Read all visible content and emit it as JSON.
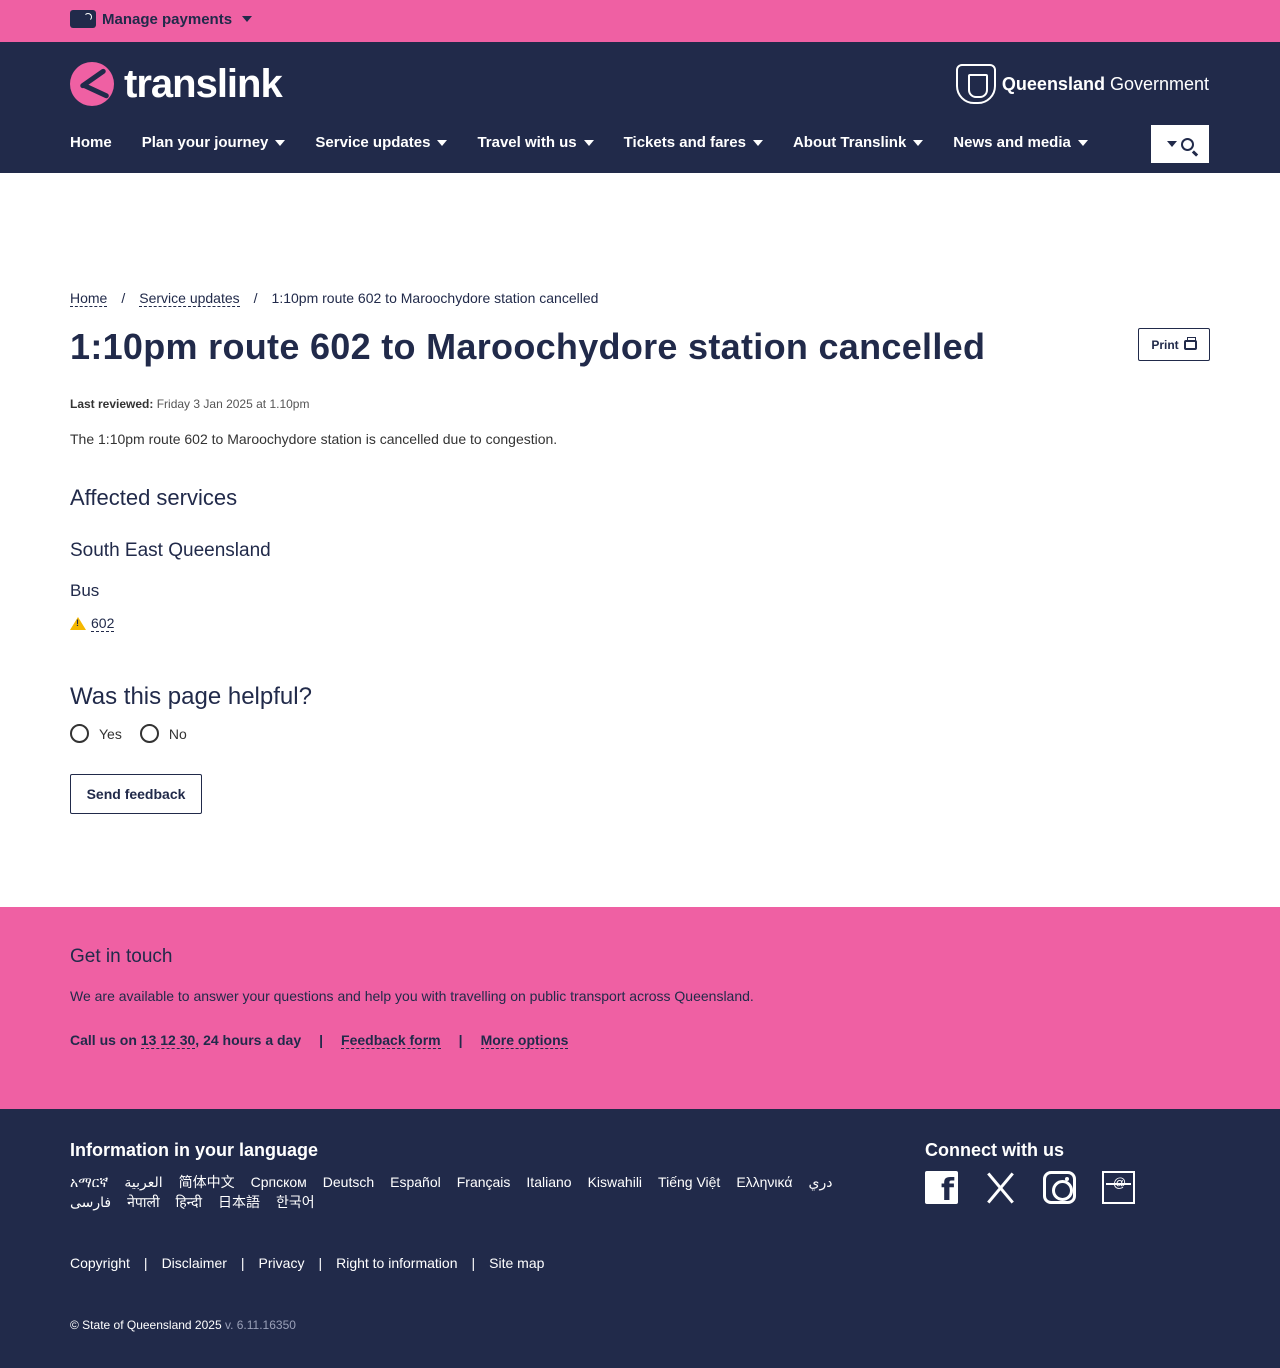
{
  "topbar": {
    "manage_payments": "Manage payments"
  },
  "header": {
    "logo_text": "translink",
    "qgov_bold": "Queensland",
    "qgov_rest": " Government",
    "nav": [
      {
        "label": "Home",
        "dropdown": false
      },
      {
        "label": "Plan your journey",
        "dropdown": true
      },
      {
        "label": "Service updates",
        "dropdown": true
      },
      {
        "label": "Travel with us",
        "dropdown": true
      },
      {
        "label": "Tickets and fares",
        "dropdown": true
      },
      {
        "label": "About Translink",
        "dropdown": true
      },
      {
        "label": "News and media",
        "dropdown": true
      }
    ]
  },
  "breadcrumb": {
    "home": "Home",
    "service_updates": "Service updates",
    "current": "1:10pm route 602 to Maroochydore station cancelled",
    "sep": "/"
  },
  "page": {
    "title": "1:10pm route 602 to Maroochydore station cancelled",
    "print_label": "Print",
    "reviewed_label": "Last reviewed:",
    "reviewed_value": "Friday 3 Jan 2025 at 1.10pm",
    "description": "The 1:10pm route 602 to Maroochydore station is cancelled due to congestion.",
    "affected_heading": "Affected services",
    "region": "South East Queensland",
    "mode": "Bus",
    "route": "602"
  },
  "feedback": {
    "heading": "Was this page helpful?",
    "yes": "Yes",
    "no": "No",
    "send": "Send feedback"
  },
  "touch": {
    "heading": "Get in touch",
    "text": "We are available to answer your questions and help you with travelling on public transport across Queensland.",
    "call_prefix": "Call us on",
    "phone": "13 12 30",
    "call_suffix": ", 24 hours a day",
    "sep": "|",
    "feedback_form": "Feedback form",
    "more_options": "More options"
  },
  "footer": {
    "lang_heading": "Information in your language",
    "languages": [
      "አማርኛ",
      "العربية",
      "简体中文",
      "Српском",
      "Deutsch",
      "Español",
      "Français",
      "Italiano",
      "Kiswahili",
      "Tiếng Việt",
      "Ελληνικά",
      "دري",
      "فارسی",
      "नेपाली",
      "हिन्दी",
      "日本語",
      "한국어"
    ],
    "connect_heading": "Connect with us",
    "social": [
      "facebook-icon",
      "x-icon",
      "instagram-icon",
      "email-icon"
    ],
    "links": [
      "Copyright",
      "Disclaimer",
      "Privacy",
      "Right to information",
      "Site map"
    ],
    "link_sep": "|",
    "copyright": "© State of Queensland 2025",
    "version": "v. 6.11.16350"
  },
  "colors": {
    "pink": "#ef60a3",
    "navy": "#212a4a"
  }
}
